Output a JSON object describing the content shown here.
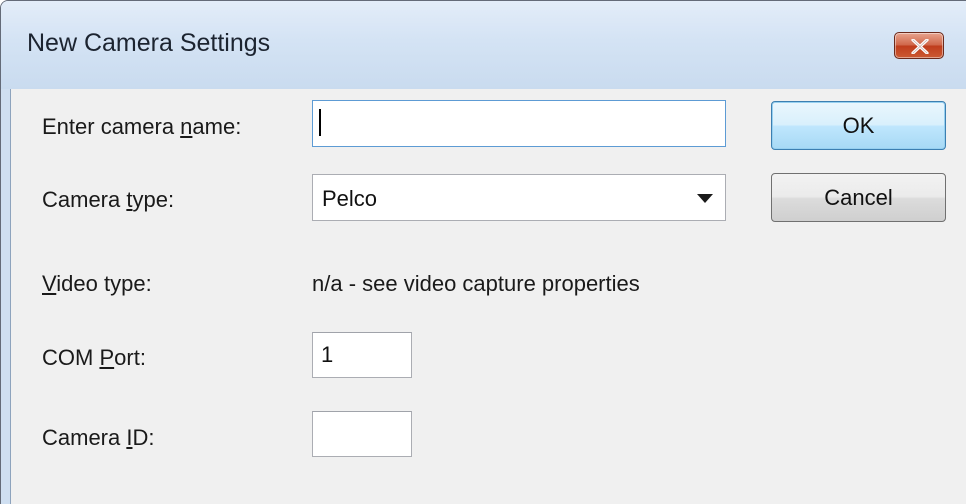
{
  "window": {
    "title": "New Camera Settings",
    "close_icon": "close-x-icon",
    "accent_color": "#c9dbef",
    "close_color": "#c74c2c"
  },
  "form": {
    "camera_name": {
      "label_prefix": "Enter camera ",
      "label_mnemonic": "n",
      "label_suffix": "ame:",
      "value": ""
    },
    "camera_type": {
      "label_prefix": "Camera ",
      "label_mnemonic": "t",
      "label_suffix": "ype:",
      "selected": "Pelco",
      "arrow_icon": "dropdown-arrow-icon"
    },
    "video_type": {
      "label_prefix": "",
      "label_mnemonic": "V",
      "label_suffix": "ideo type:",
      "value": "n/a - see video capture properties"
    },
    "com_port": {
      "label_prefix": "COM ",
      "label_mnemonic": "P",
      "label_suffix": "ort:",
      "value": "1"
    },
    "camera_id": {
      "label_prefix": "Camera ",
      "label_mnemonic": "I",
      "label_suffix": "D:",
      "value": ""
    }
  },
  "buttons": {
    "ok": "OK",
    "cancel": "Cancel"
  }
}
